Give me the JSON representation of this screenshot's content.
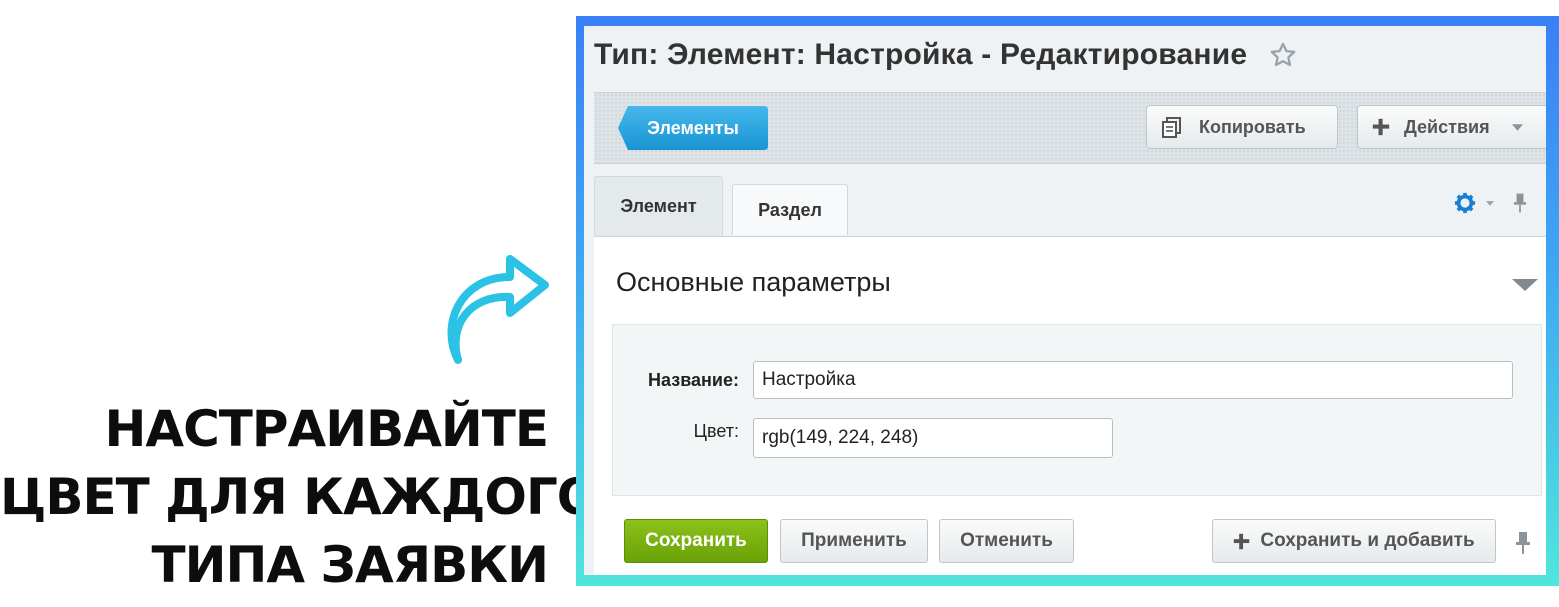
{
  "promo": {
    "lines": [
      "НАСТРАИВАЙТЕ",
      "ЦВЕТ ДЛЯ КАЖДОГО",
      "ТИПА ЗАЯВКИ"
    ]
  },
  "page": {
    "title": "Тип: Элемент: Настройка - Редактирование"
  },
  "toolbar": {
    "elements_label": "Элементы",
    "copy_label": "Копировать",
    "actions_label": "Действия"
  },
  "tabs": [
    {
      "label": "Элемент",
      "active": true
    },
    {
      "label": "Раздел",
      "active": false
    }
  ],
  "section": {
    "title": "Основные параметры"
  },
  "form": {
    "name_label": "Название:",
    "name_value": "Настройка",
    "color_label": "Цвет:",
    "color_value": "rgb(149, 224, 248)"
  },
  "actions": {
    "save_label": "Сохранить",
    "apply_label": "Применить",
    "cancel_label": "Отменить",
    "save_add_label": "Сохранить и добавить"
  },
  "colors": {
    "primary_blue": "#1a94d4",
    "save_green": "#6aa107",
    "frame_top": "#3a7ff7",
    "frame_bottom": "#4fe6dc",
    "arrow": "#2ac3e6"
  }
}
